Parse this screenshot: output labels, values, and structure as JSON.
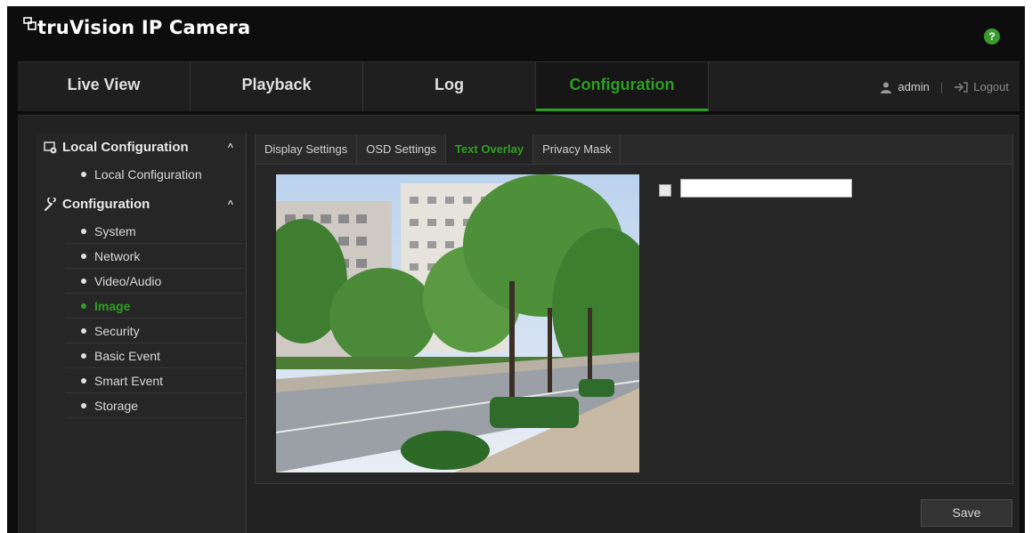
{
  "app": {
    "title": "truVision IP Camera",
    "help_label": "?"
  },
  "nav": {
    "tabs": [
      {
        "label": "Live View"
      },
      {
        "label": "Playback"
      },
      {
        "label": "Log"
      },
      {
        "label": "Configuration",
        "active": true
      }
    ],
    "user": "admin",
    "separator": "|",
    "logout": "Logout"
  },
  "sidebar": {
    "sections": [
      {
        "label": "Local Configuration",
        "icon": "local-config-icon",
        "items": [
          "Local Configuration"
        ]
      },
      {
        "label": "Configuration",
        "icon": "wrench-icon",
        "items": [
          "System",
          "Network",
          "Video/Audio",
          "Image",
          "Security",
          "Basic Event",
          "Smart Event",
          "Storage"
        ]
      }
    ],
    "active_item": "Image"
  },
  "content": {
    "tabs": [
      "Display Settings",
      "OSD Settings",
      "Text Overlay",
      "Privacy Mask"
    ],
    "active_tab": "Text Overlay",
    "overlay_text_value": "",
    "overlay_checkbox_checked": false
  },
  "save_label": "Save",
  "colors": {
    "accent": "#2f9e24",
    "background": "#0d0d0d",
    "panel": "#222222"
  }
}
